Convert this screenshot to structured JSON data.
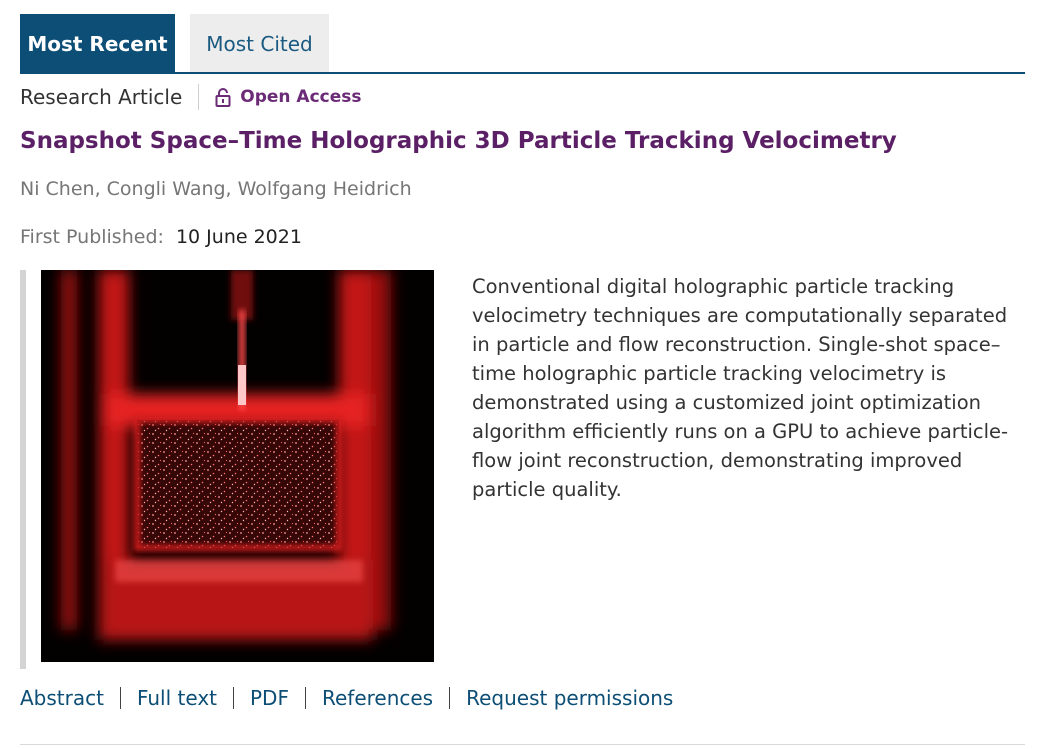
{
  "tabs": [
    {
      "label": "Most Recent",
      "active": true
    },
    {
      "label": "Most Cited",
      "active": false
    }
  ],
  "article": {
    "type": "Research Article",
    "access_label": "Open Access",
    "access_icon": "open-lock-icon",
    "title": "Snapshot Space–Time Holographic 3D Particle Tracking Velocimetry",
    "authors": "Ni Chen, Congli Wang, Wolfgang Heidrich",
    "published_label": "First Published:",
    "published_date": "10 June 2021",
    "abstract": "Conventional digital holographic particle tracking velocimetry techniques are computationally separated in particle and flow reconstruction. Single-shot space–time holographic particle tracking velocimetry is demonstrated using a customized joint optimization algorithm efficiently runs on a GPU to achieve particle-flow joint reconstruction, demonstrating improved particle quality."
  },
  "links": [
    "Abstract",
    "Full text",
    "PDF",
    "References",
    "Request permissions"
  ],
  "colors": {
    "tab_active": "#0c4e75",
    "tab_inactive": "#ededed",
    "title": "#5b1f66",
    "access": "#6b2b76",
    "link": "#0c4e75"
  }
}
